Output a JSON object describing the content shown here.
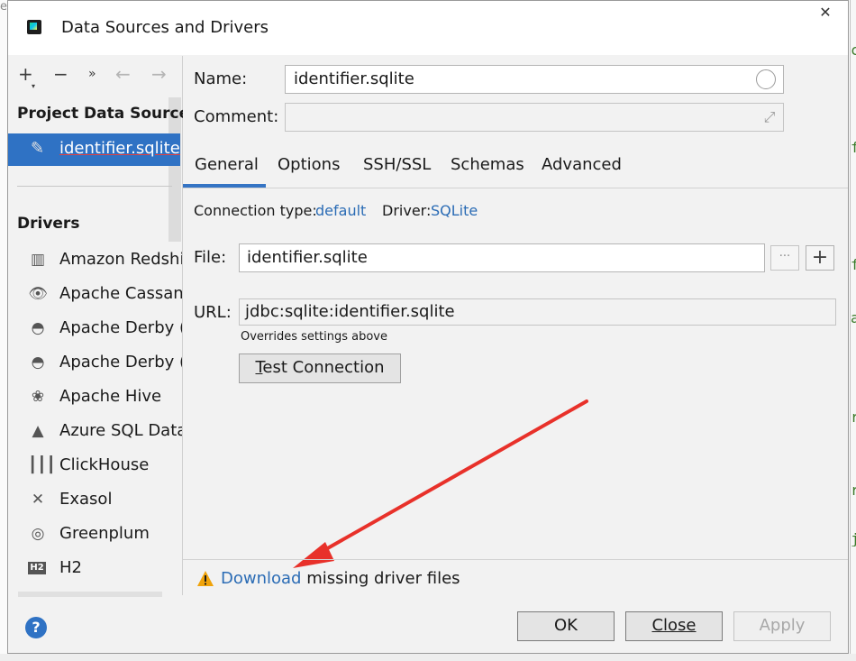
{
  "window": {
    "title": "Data Sources and Drivers"
  },
  "toolbar": {
    "add": "+",
    "remove": "−",
    "more": "»",
    "back": "←",
    "forward": "→"
  },
  "left": {
    "project_header": "Project Data Sources",
    "selected_source": "identifier.sqlite",
    "drivers_header": "Drivers",
    "drivers": [
      {
        "label": "Amazon Redshi",
        "icon": "redshift-icon"
      },
      {
        "label": "Apache Cassand",
        "icon": "cassandra-eye-icon"
      },
      {
        "label": "Apache Derby (",
        "icon": "derby-hat-icon"
      },
      {
        "label": "Apache Derby (",
        "icon": "derby-hat-icon"
      },
      {
        "label": "Apache Hive",
        "icon": "hive-bee-icon"
      },
      {
        "label": "Azure SQL Data",
        "icon": "azure-icon"
      },
      {
        "label": "ClickHouse",
        "icon": "clickhouse-bars-icon"
      },
      {
        "label": "Exasol",
        "icon": "exasol-x-icon"
      },
      {
        "label": "Greenplum",
        "icon": "greenplum-icon"
      },
      {
        "label": "H2",
        "icon": "h2-icon"
      }
    ]
  },
  "form": {
    "name_label": "Name:",
    "name_value": "identifier.sqlite",
    "comment_label": "Comment:",
    "comment_value": "",
    "tabs": [
      "General",
      "Options",
      "SSH/SSL",
      "Schemas",
      "Advanced"
    ],
    "active_tab": "General",
    "connection_type_label": "Connection type:",
    "connection_type_value": "default",
    "driver_label": "Driver:",
    "driver_value": "SQLite",
    "file_label": "File:",
    "file_value": "identifier.sqlite",
    "browse_label": "···",
    "add_label": "+",
    "url_label": "URL:",
    "url_value": "jdbc:sqlite:identifier.sqlite",
    "overrides_note": "Overrides settings above",
    "test_connection_label": "Test Connection"
  },
  "warning": {
    "link": "Download",
    "text": " missing driver files"
  },
  "footer": {
    "help": "?",
    "ok": "OK",
    "close": "Close",
    "apply": "Apply"
  },
  "colors": {
    "accent": "#2f72c4",
    "link": "#2b6cb5",
    "annotation_arrow": "#e8312a",
    "warning": "#f0a30a"
  }
}
